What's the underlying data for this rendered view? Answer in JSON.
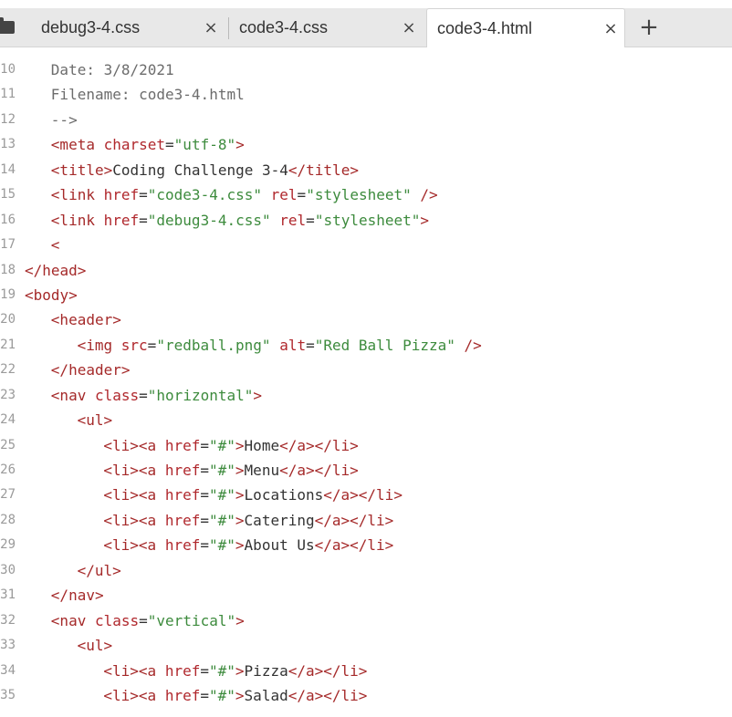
{
  "tabs": [
    {
      "label": "debug3-4.css",
      "close": "×",
      "active": false
    },
    {
      "label": "code3-4.css",
      "close": "×",
      "active": false
    },
    {
      "label": "code3-4.html",
      "close": "×",
      "active": true
    }
  ],
  "new_tab_label": "+",
  "icons": {
    "folder": "folder-icon",
    "close": "close-icon",
    "plus": "plus-icon"
  },
  "editor": {
    "lines": [
      {
        "num": "10",
        "indent": 1,
        "tokens": [
          {
            "t": "comment",
            "v": "Date: 3/8/2021"
          }
        ]
      },
      {
        "num": "11",
        "indent": 1,
        "tokens": [
          {
            "t": "comment",
            "v": "Filename: code3-4.html"
          }
        ]
      },
      {
        "num": "12",
        "indent": 1,
        "tokens": [
          {
            "t": "comment",
            "v": "-->"
          }
        ]
      },
      {
        "num": "13",
        "indent": 1,
        "tokens": [
          {
            "t": "tag",
            "v": "<meta "
          },
          {
            "t": "attr",
            "v": "charset"
          },
          {
            "t": "text",
            "v": "="
          },
          {
            "t": "val",
            "v": "\"utf-8\""
          },
          {
            "t": "tag",
            "v": ">"
          }
        ]
      },
      {
        "num": "14",
        "indent": 1,
        "tokens": [
          {
            "t": "tag",
            "v": "<title>"
          },
          {
            "t": "text",
            "v": "Coding Challenge 3-4"
          },
          {
            "t": "tag",
            "v": "</title>"
          }
        ]
      },
      {
        "num": "15",
        "indent": 1,
        "tokens": [
          {
            "t": "tag",
            "v": "<link "
          },
          {
            "t": "attr",
            "v": "href"
          },
          {
            "t": "text",
            "v": "="
          },
          {
            "t": "val",
            "v": "\"code3-4.css\""
          },
          {
            "t": "text",
            "v": " "
          },
          {
            "t": "attr",
            "v": "rel"
          },
          {
            "t": "text",
            "v": "="
          },
          {
            "t": "val",
            "v": "\"stylesheet\""
          },
          {
            "t": "tag",
            "v": " />"
          }
        ]
      },
      {
        "num": "16",
        "indent": 1,
        "tokens": [
          {
            "t": "tag",
            "v": "<link "
          },
          {
            "t": "attr",
            "v": "href"
          },
          {
            "t": "text",
            "v": "="
          },
          {
            "t": "val",
            "v": "\"debug3-4.css\""
          },
          {
            "t": "text",
            "v": " "
          },
          {
            "t": "attr",
            "v": "rel"
          },
          {
            "t": "text",
            "v": "="
          },
          {
            "t": "val",
            "v": "\"stylesheet\""
          },
          {
            "t": "tag",
            "v": ">"
          }
        ]
      },
      {
        "num": "17",
        "indent": 1,
        "tokens": [
          {
            "t": "tag",
            "v": "<"
          }
        ]
      },
      {
        "num": "18",
        "indent": 0,
        "tokens": [
          {
            "t": "tag",
            "v": "</head>"
          }
        ]
      },
      {
        "num": "19",
        "indent": 0,
        "tokens": [
          {
            "t": "tag",
            "v": "<body>"
          }
        ]
      },
      {
        "num": "20",
        "indent": 1,
        "tokens": [
          {
            "t": "tag",
            "v": "<header>"
          }
        ]
      },
      {
        "num": "21",
        "indent": 2,
        "tokens": [
          {
            "t": "tag",
            "v": "<img "
          },
          {
            "t": "attr",
            "v": "src"
          },
          {
            "t": "text",
            "v": "="
          },
          {
            "t": "val",
            "v": "\"redball.png\""
          },
          {
            "t": "text",
            "v": " "
          },
          {
            "t": "attr",
            "v": "alt"
          },
          {
            "t": "text",
            "v": "="
          },
          {
            "t": "val",
            "v": "\"Red Ball Pizza\""
          },
          {
            "t": "tag",
            "v": " />"
          }
        ]
      },
      {
        "num": "22",
        "indent": 1,
        "tokens": [
          {
            "t": "tag",
            "v": "</header>"
          }
        ]
      },
      {
        "num": "23",
        "indent": 1,
        "tokens": [
          {
            "t": "tag",
            "v": "<nav "
          },
          {
            "t": "attr",
            "v": "class"
          },
          {
            "t": "text",
            "v": "="
          },
          {
            "t": "val",
            "v": "\"horizontal\""
          },
          {
            "t": "tag",
            "v": ">"
          }
        ]
      },
      {
        "num": "24",
        "indent": 2,
        "tokens": [
          {
            "t": "tag",
            "v": "<ul>"
          }
        ]
      },
      {
        "num": "25",
        "indent": 3,
        "tokens": [
          {
            "t": "tag",
            "v": "<li><a "
          },
          {
            "t": "attr",
            "v": "href"
          },
          {
            "t": "text",
            "v": "="
          },
          {
            "t": "val",
            "v": "\"#\""
          },
          {
            "t": "tag",
            "v": ">"
          },
          {
            "t": "text",
            "v": "Home"
          },
          {
            "t": "tag",
            "v": "</a></li>"
          }
        ]
      },
      {
        "num": "26",
        "indent": 3,
        "tokens": [
          {
            "t": "tag",
            "v": "<li><a "
          },
          {
            "t": "attr",
            "v": "href"
          },
          {
            "t": "text",
            "v": "="
          },
          {
            "t": "val",
            "v": "\"#\""
          },
          {
            "t": "tag",
            "v": ">"
          },
          {
            "t": "text",
            "v": "Menu"
          },
          {
            "t": "tag",
            "v": "</a></li>"
          }
        ]
      },
      {
        "num": "27",
        "indent": 3,
        "tokens": [
          {
            "t": "tag",
            "v": "<li><a "
          },
          {
            "t": "attr",
            "v": "href"
          },
          {
            "t": "text",
            "v": "="
          },
          {
            "t": "val",
            "v": "\"#\""
          },
          {
            "t": "tag",
            "v": ">"
          },
          {
            "t": "text",
            "v": "Locations"
          },
          {
            "t": "tag",
            "v": "</a></li>"
          }
        ]
      },
      {
        "num": "28",
        "indent": 3,
        "tokens": [
          {
            "t": "tag",
            "v": "<li><a "
          },
          {
            "t": "attr",
            "v": "href"
          },
          {
            "t": "text",
            "v": "="
          },
          {
            "t": "val",
            "v": "\"#\""
          },
          {
            "t": "tag",
            "v": ">"
          },
          {
            "t": "text",
            "v": "Catering"
          },
          {
            "t": "tag",
            "v": "</a></li>"
          }
        ]
      },
      {
        "num": "29",
        "indent": 3,
        "tokens": [
          {
            "t": "tag",
            "v": "<li><a "
          },
          {
            "t": "attr",
            "v": "href"
          },
          {
            "t": "text",
            "v": "="
          },
          {
            "t": "val",
            "v": "\"#\""
          },
          {
            "t": "tag",
            "v": ">"
          },
          {
            "t": "text",
            "v": "About Us"
          },
          {
            "t": "tag",
            "v": "</a></li>"
          }
        ]
      },
      {
        "num": "30",
        "indent": 2,
        "tokens": [
          {
            "t": "tag",
            "v": "</ul>"
          }
        ]
      },
      {
        "num": "31",
        "indent": 1,
        "tokens": [
          {
            "t": "tag",
            "v": "</nav>"
          }
        ]
      },
      {
        "num": "32",
        "indent": 1,
        "tokens": [
          {
            "t": "tag",
            "v": "<nav "
          },
          {
            "t": "attr",
            "v": "class"
          },
          {
            "t": "text",
            "v": "="
          },
          {
            "t": "val",
            "v": "\"vertical\""
          },
          {
            "t": "tag",
            "v": ">"
          }
        ]
      },
      {
        "num": "33",
        "indent": 2,
        "tokens": [
          {
            "t": "tag",
            "v": "<ul>"
          }
        ]
      },
      {
        "num": "34",
        "indent": 3,
        "tokens": [
          {
            "t": "tag",
            "v": "<li><a "
          },
          {
            "t": "attr",
            "v": "href"
          },
          {
            "t": "text",
            "v": "="
          },
          {
            "t": "val",
            "v": "\"#\""
          },
          {
            "t": "tag",
            "v": ">"
          },
          {
            "t": "text",
            "v": "Pizza"
          },
          {
            "t": "tag",
            "v": "</a></li>"
          }
        ]
      },
      {
        "num": "35",
        "indent": 3,
        "tokens": [
          {
            "t": "tag",
            "v": "<li><a "
          },
          {
            "t": "attr",
            "v": "href"
          },
          {
            "t": "text",
            "v": "="
          },
          {
            "t": "val",
            "v": "\"#\""
          },
          {
            "t": "tag",
            "v": ">"
          },
          {
            "t": "text",
            "v": "Salad"
          },
          {
            "t": "tag",
            "v": "</a></li>"
          }
        ]
      }
    ]
  }
}
